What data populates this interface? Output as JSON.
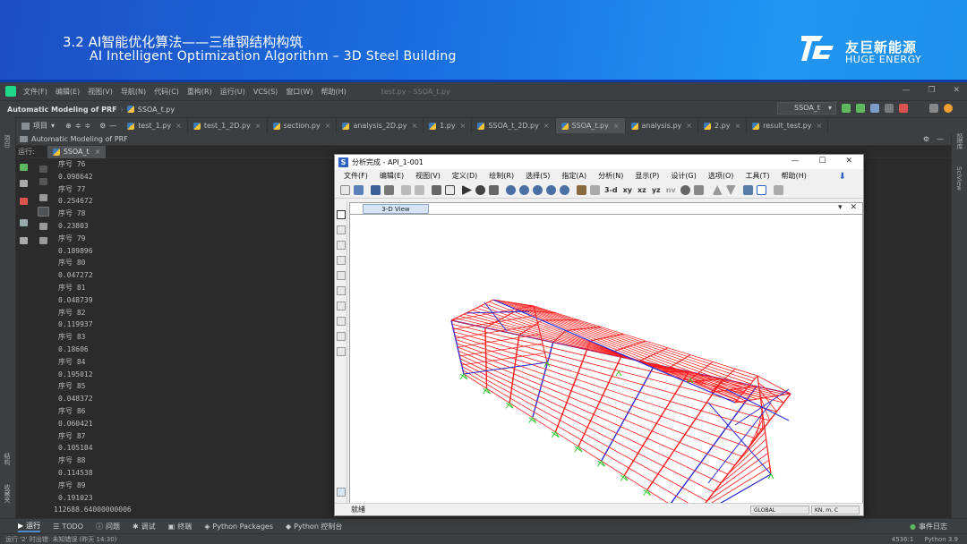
{
  "slide": {
    "title_cn": "3.2  AI智能优化算法——三维钢结构构筑",
    "title_en": "AI Intelligent Optimization Algorithm – 3D Steel Building",
    "brand_cn": "友巨新能源",
    "brand_en": "HUGE ENERGY",
    "brand_colors": {
      "banner_start": "#1d4fc4",
      "banner_end": "#2196f3"
    }
  },
  "ide": {
    "menu": [
      "文件(F)",
      "编辑(E)",
      "视图(V)",
      "导航(N)",
      "代码(C)",
      "重构(R)",
      "运行(U)",
      "VCS(S)",
      "窗口(W)",
      "帮助(H)"
    ],
    "window_title": "test.py - SSOA_t.py",
    "project": "Automatic Modeling of PRF",
    "current_file": "SSOA_t.py",
    "run_config": "SSOA_t",
    "project_tool": "项目",
    "tabs": [
      "test_1.py",
      "test_1_2D.py",
      "section.py",
      "analysis_2D.py",
      "1.py",
      "SSOA_t_2D.py",
      "SSOA_t.py",
      "analysis.py",
      "2.py",
      "result_test.py"
    ],
    "active_tab": "SSOA_t.py",
    "run_panel": {
      "header": "Automatic Modeling of PRF",
      "label": "运行:",
      "tab": "SSOA_t"
    },
    "console_lines": [
      "序号 76",
      "0.098642",
      "序号 77",
      "0.254672",
      "序号 78",
      "0.23803",
      "序号 79",
      "0.189896",
      "序号 80",
      "0.047272",
      "序号 81",
      "0.048739",
      "序号 82",
      "0.119937",
      "序号 83",
      "0.18606",
      "序号 84",
      "0.195012",
      "序号 85",
      "0.048372",
      "序号 86",
      "0.060421",
      "序号 87",
      "0.105184",
      "序号 88",
      "0.114538",
      "序号 89",
      "0.191023",
      "112688.64000000006"
    ],
    "left_strip": {
      "top": "项目",
      "middle": "结构",
      "bottom": "收藏夹"
    },
    "right_strip": {
      "top": "数据库",
      "bottom": "SciView"
    },
    "bottom_tabs": [
      "运行",
      "TODO",
      "问题",
      "调试",
      "终端",
      "Python Packages",
      "Python 控制台"
    ],
    "event_log": "事件日志",
    "status_message": "运行 '2' 时出错: 未知错误 (昨天 14:30)",
    "cursor_pos": "4536:1",
    "interpreter": "Python 3.9"
  },
  "sap": {
    "title": "分析完成 - API_1-001",
    "icon_letter": "S",
    "menu": [
      "文件(F)",
      "编辑(E)",
      "视图(V)",
      "定义(D)",
      "绘制(R)",
      "选择(S)",
      "指定(A)",
      "分析(N)",
      "显示(P)",
      "设计(G)",
      "选项(O)",
      "工具(T)",
      "帮助(H)"
    ],
    "toolbar_text": [
      "3-d",
      "xy",
      "xz",
      "yz",
      "nv"
    ],
    "view_tab": "3-D View",
    "status": "就绪",
    "coord_system": "GLOBAL",
    "units": "KN, m, C",
    "frame_color": "#ff1a1a",
    "brace_color": "#2a2ad8",
    "support_color": "#33cc33"
  }
}
